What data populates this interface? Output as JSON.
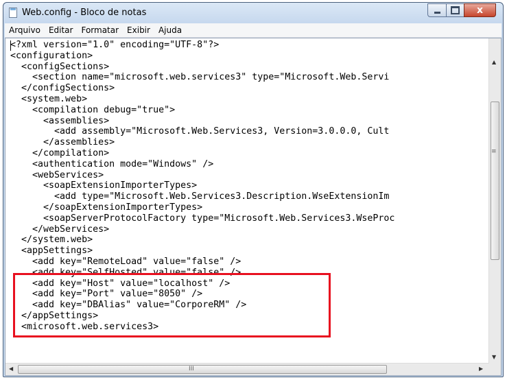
{
  "window": {
    "title": "Web.config - Bloco de notas"
  },
  "menu": [
    "Arquivo",
    "Editar",
    "Formatar",
    "Exibir",
    "Ajuda"
  ],
  "content_lines": [
    "<?xml version=\"1.0\" encoding=\"UTF-8\"?>",
    "<configuration>",
    "  <configSections>",
    "    <section name=\"microsoft.web.services3\" type=\"Microsoft.Web.Servi",
    "  </configSections>",
    "  <system.web>",
    "    <compilation debug=\"true\">",
    "      <assemblies>",
    "        <add assembly=\"Microsoft.Web.Services3, Version=3.0.0.0, Cult",
    "      </assemblies>",
    "    </compilation>",
    "    <authentication mode=\"Windows\" />",
    "    <webServices>",
    "      <soapExtensionImporterTypes>",
    "        <add type=\"Microsoft.Web.Services3.Description.WseExtensionIm",
    "      </soapExtensionImporterTypes>",
    "      <soapServerProtocolFactory type=\"Microsoft.Web.Services3.WseProc",
    "    </webServices>",
    "  </system.web>",
    "  <appSettings>",
    "    <add key=\"RemoteLoad\" value=\"false\" />",
    "    <add key=\"SelfHosted\" value=\"false\" />",
    "    <add key=\"Host\" value=\"localhost\" />",
    "    <add key=\"Port\" value=\"8050\" />",
    "    <add key=\"DBAlias\" value=\"CorporeRM\" />",
    "  </appSettings>",
    "  <microsoft.web.services3>"
  ],
  "scrollbar": {
    "v_up": "▲",
    "v_down": "▼",
    "h_left": "◀",
    "h_right": "▶",
    "grip_v": "≡",
    "grip_h": "III"
  },
  "controls": {
    "minimize": "minimize",
    "maximize": "maximize",
    "close": "x"
  },
  "colors": {
    "highlight_border": "#e8101f"
  }
}
